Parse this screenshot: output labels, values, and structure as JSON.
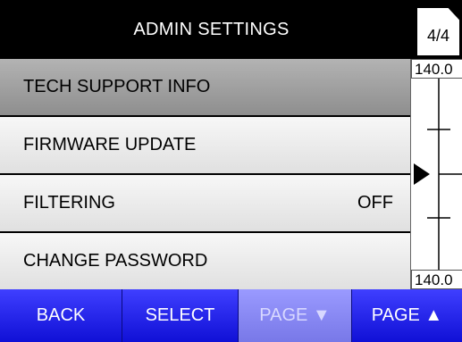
{
  "header": {
    "title": "ADMIN SETTINGS",
    "page_indicator": "4/4"
  },
  "menu": {
    "items": [
      {
        "label": "TECH SUPPORT INFO",
        "value": "",
        "selected": true
      },
      {
        "label": "FIRMWARE UPDATE",
        "value": ""
      },
      {
        "label": "FILTERING",
        "value": "OFF"
      },
      {
        "label": "CHANGE PASSWORD",
        "value": ""
      }
    ]
  },
  "gauge": {
    "top_label": "140.0",
    "bottom_label": "140.0",
    "pointer_icon": "triangle-pointer-right"
  },
  "softkeys": {
    "back": "BACK",
    "select": "SELECT",
    "page_down": "PAGE ▼",
    "page_up": "PAGE ▲"
  },
  "colors": {
    "softkey": "#2a2af0",
    "softkey_disabled": "#8a8af5",
    "selected_item": "#9e9e9e",
    "header_bg": "#000000"
  }
}
